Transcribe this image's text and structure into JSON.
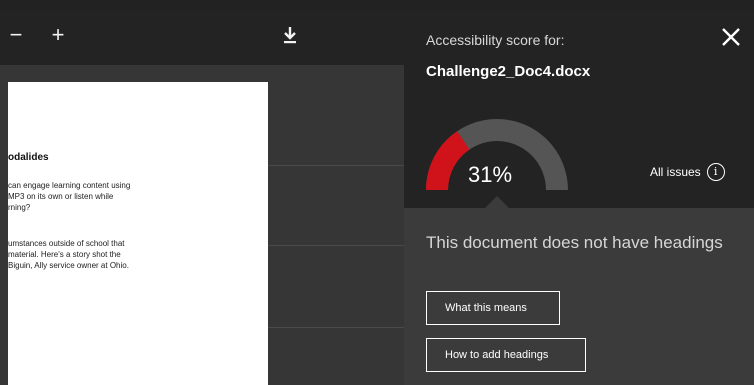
{
  "toolbar": {
    "zoom_out_icon": "minus-icon",
    "zoom_in_icon": "plus-icon",
    "download_icon": "download-icon"
  },
  "document": {
    "heading": "odalides",
    "paragraph1": "can engage learning content using\nMP3 on its own or listen while\nrning?",
    "paragraph2": "umstances outside of school that\nmaterial. Here's a story shot the\nBiguin, Ally service owner at Ohio."
  },
  "panel": {
    "score_label": "Accessibility score for:",
    "file_name": "Challenge2_Doc4.docx",
    "close_icon": "close-icon",
    "all_issues_label": "All issues",
    "info_icon": "info-icon"
  },
  "score": {
    "value_text": "31%",
    "fraction": 0.31,
    "fill_color": "#d0121b",
    "track_color": "#555555"
  },
  "issue": {
    "title": "This document does not have headings",
    "button_meaning": "What this means",
    "button_howto": "How to add headings"
  },
  "colors": {
    "panel_bg": "#232323",
    "card_bg": "#3b3b3b",
    "viewer_bg": "#363636"
  }
}
